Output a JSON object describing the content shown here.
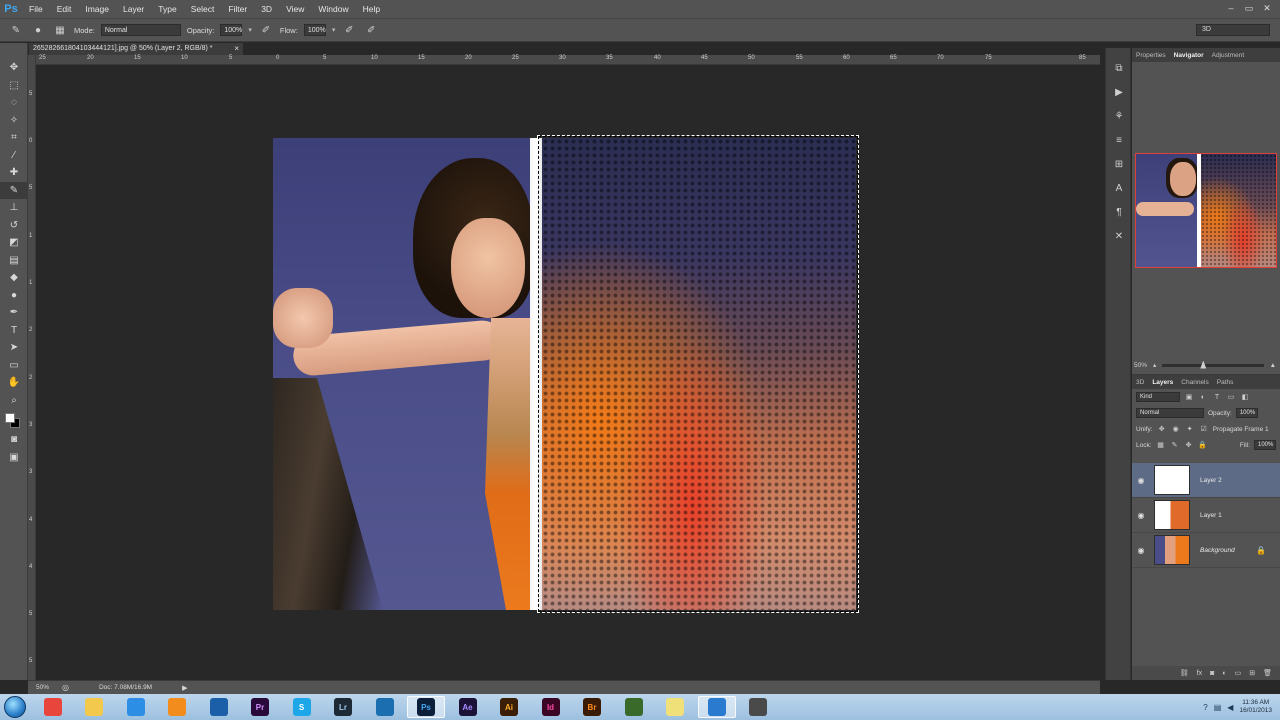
{
  "app": {
    "logo": "Ps"
  },
  "menu": [
    "File",
    "Edit",
    "Image",
    "Layer",
    "Type",
    "Select",
    "Filter",
    "3D",
    "View",
    "Window",
    "Help"
  ],
  "window_controls": [
    "–",
    "▭",
    "✕"
  ],
  "options": {
    "mode_label": "Mode:",
    "mode_value": "Normal",
    "opacity_label": "Opacity:",
    "opacity_value": "100%",
    "flow_label": "Flow:",
    "flow_value": "100%",
    "workspace": "3D"
  },
  "document_tab": {
    "title": "265282661804103444121].jpg @ 50% (Layer 2, RGB/8) *",
    "close": "×"
  },
  "ruler_top": [
    "25",
    "20",
    "15",
    "10",
    "5",
    "0",
    "5",
    "10",
    "15",
    "20",
    "25",
    "30",
    "35",
    "40",
    "45",
    "50",
    "55",
    "60",
    "65",
    "70",
    "75",
    "85"
  ],
  "ruler_left": [
    "5",
    "0",
    "5",
    "1",
    "1",
    "2",
    "2",
    "3",
    "3",
    "4",
    "4",
    "5",
    "5"
  ],
  "status": {
    "zoom": "50%",
    "doc": "Doc: 7.08M/16.9M"
  },
  "panels": {
    "top_tabs": [
      "Properties",
      "Navigator",
      "Adjustment"
    ],
    "active_top_tab": "Navigator",
    "navigator_zoom": "50%",
    "layer_tabs": [
      "3D",
      "Layers",
      "Channels",
      "Paths"
    ],
    "active_layer_tab": "Layers",
    "kind": "Kind",
    "blend_mode": "Normal",
    "opacity_label": "Opacity:",
    "opacity_value": "100%",
    "unify_label": "Unify:",
    "propagate_label": "Propagate Frame 1",
    "lock_label": "Lock:",
    "fill_label": "Fill:",
    "fill_value": "100%",
    "layers": [
      {
        "name": "Layer 2",
        "selected": true,
        "italic": false
      },
      {
        "name": "Layer 1",
        "selected": false,
        "italic": false
      },
      {
        "name": "Background",
        "selected": false,
        "italic": true,
        "locked": true
      }
    ]
  },
  "taskbar": {
    "apps": [
      {
        "label": "",
        "icon": "chrome-icon",
        "color": "#e8453c"
      },
      {
        "label": "",
        "icon": "folder-icon",
        "color": "#f2c94c"
      },
      {
        "label": "",
        "icon": "ie-icon",
        "color": "#2d8ee6"
      },
      {
        "label": "",
        "icon": "media-player-icon",
        "color": "#f28c1c"
      },
      {
        "label": "",
        "icon": "hp-icon",
        "color": "#1b5fa8"
      },
      {
        "label": "Pr",
        "icon": "premiere-icon",
        "color": "#2a0a3a",
        "text": "#d690ff"
      },
      {
        "label": "S",
        "icon": "skype-icon",
        "color": "#1ea7e8",
        "text": "#ffffff"
      },
      {
        "label": "Lr",
        "icon": "lightroom-icon",
        "color": "#1d2a36",
        "text": "#9ec6e8"
      },
      {
        "label": "",
        "icon": "globe-icon",
        "color": "#1b6fb0"
      },
      {
        "label": "Ps",
        "icon": "photoshop-icon",
        "color": "#0b1f3a",
        "text": "#41a8f0",
        "active": true
      },
      {
        "label": "Ae",
        "icon": "after-effects-icon",
        "color": "#1c1238",
        "text": "#a88cff"
      },
      {
        "label": "Ai",
        "icon": "illustrator-icon",
        "color": "#3a1e06",
        "text": "#ffae2c"
      },
      {
        "label": "Id",
        "icon": "indesign-icon",
        "color": "#3a0624",
        "text": "#ff4aa8"
      },
      {
        "label": "Br",
        "icon": "bridge-icon",
        "color": "#3a1c06",
        "text": "#ff8c1c"
      },
      {
        "label": "",
        "icon": "app-icon",
        "color": "#3a6a2a"
      },
      {
        "label": "",
        "icon": "notes-icon",
        "color": "#f0e07a"
      },
      {
        "label": "",
        "icon": "monitor-icon",
        "color": "#2a7ad0",
        "active": true
      },
      {
        "label": "",
        "icon": "tool-icon",
        "color": "#4a4a4a"
      }
    ],
    "time": "11:36 AM",
    "date": "16/01/2013"
  }
}
